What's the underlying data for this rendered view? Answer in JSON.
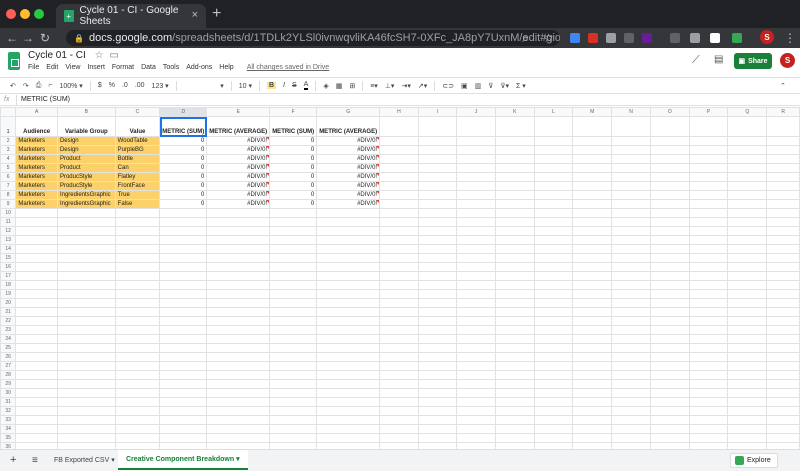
{
  "browser": {
    "tab_title": "Cycle 01 - CI - Google Sheets",
    "url_host": "docs.google.com",
    "url_path": "/spreadsheets/d/1TDLk2YLSl0ivnwqvliKA46fcSH7-0XFc_JA8pY7UxnM/edit#gid=1...",
    "avatar_initial": "S"
  },
  "doc": {
    "title": "Cycle 01 - CI",
    "menus": [
      "File",
      "Edit",
      "View",
      "Insert",
      "Format",
      "Data",
      "Tools",
      "Add-ons",
      "Help"
    ],
    "saved_status": "All changes saved in Drive",
    "share_label": "Share",
    "avatar_initial": "S"
  },
  "toolbar": {
    "zoom": "100%",
    "currency": "$",
    "percent": "%",
    "decimal_dec": ".0",
    "decimal_inc": ".00",
    "format_more": "123",
    "font_size": "10",
    "bold": "B",
    "italic": "I",
    "strike": "S",
    "text_color": "A",
    "functions": "Σ"
  },
  "formula_bar": {
    "fx": "fx",
    "value": "METRIC (SUM)"
  },
  "columns": [
    "A",
    "B",
    "C",
    "D",
    "E",
    "F",
    "G",
    "H",
    "I",
    "J",
    "K",
    "L",
    "M",
    "N",
    "O",
    "P",
    "Q",
    "R"
  ],
  "header_row": [
    "Audience",
    "Variable Group",
    "Value",
    "METRIC (SUM)",
    "METRIC (AVERAGE)",
    "METRIC (SUM)",
    "METRIC (AVERAGE)"
  ],
  "rows": [
    [
      "Marketers",
      "Design",
      "WoodTable",
      "0",
      "#DIV/0!",
      "0",
      "#DIV/0!"
    ],
    [
      "Marketers",
      "Design",
      "PurpleBG",
      "0",
      "#DIV/0!",
      "0",
      "#DIV/0!"
    ],
    [
      "Marketers",
      "Product",
      "Bottle",
      "0",
      "#DIV/0!",
      "0",
      "#DIV/0!"
    ],
    [
      "Marketers",
      "Product",
      "Can",
      "0",
      "#DIV/0!",
      "0",
      "#DIV/0!"
    ],
    [
      "Marketers",
      "ProducStyle",
      "Flatley",
      "0",
      "#DIV/0!",
      "0",
      "#DIV/0!"
    ],
    [
      "Marketers",
      "ProducStyle",
      "FrontFace",
      "0",
      "#DIV/0!",
      "0",
      "#DIV/0!"
    ],
    [
      "Marketers",
      "IngredientsGraphic",
      "True",
      "0",
      "#DIV/0!",
      "0",
      "#DIV/0!"
    ],
    [
      "Marketers",
      "IngredientsGraphic",
      "False",
      "0",
      "#DIV/0!",
      "0",
      "#DIV/0!"
    ]
  ],
  "sheets": {
    "add": "+",
    "list": "≡",
    "tab1": "FB Exported CSV",
    "tab2": "Creative Component Breakdown",
    "explore": "Explore"
  },
  "colors": {
    "highlight": "#fcd169",
    "accent": "#188038",
    "selection": "#1a73e8"
  }
}
